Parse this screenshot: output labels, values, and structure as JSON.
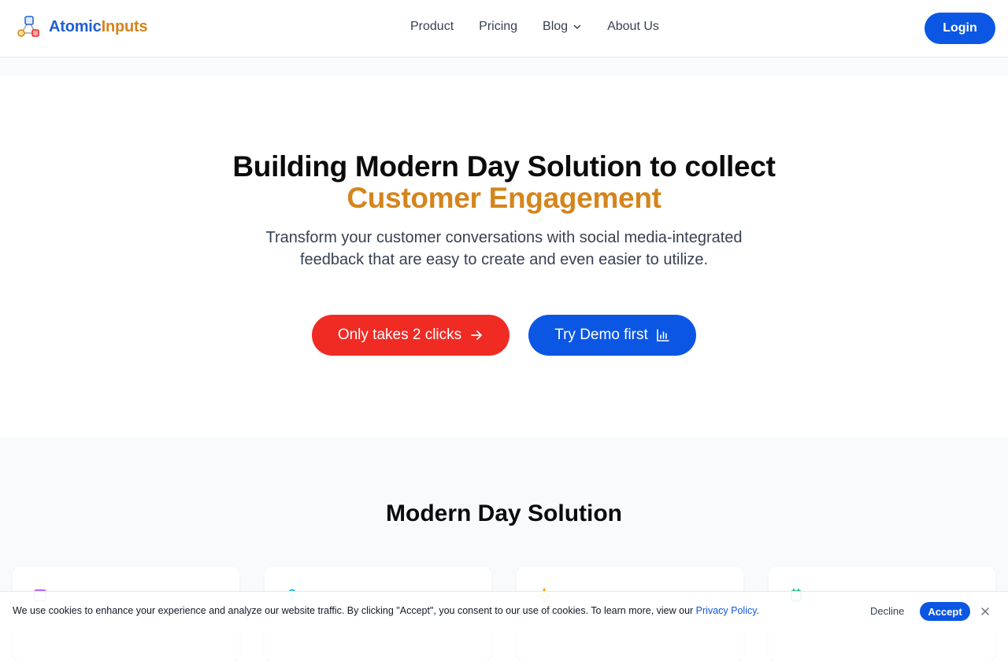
{
  "header": {
    "logo_text_a": "Atomic",
    "logo_text_b": "Inputs",
    "nav": [
      {
        "label": "Product"
      },
      {
        "label": "Pricing"
      },
      {
        "label": "Blog",
        "icon": "chevron-down-icon"
      },
      {
        "label": "About Us"
      }
    ],
    "login_label": "Login"
  },
  "hero": {
    "title_line1": "Building Modern Day Solution to collect",
    "title_line2": "Customer Engagement",
    "subtitle_line1": "Transform your customer conversations with social media-integrated",
    "subtitle_line2": "feedback that are easy to create and even easier to utilize.",
    "primary_cta": {
      "label": "Only takes 2 clicks",
      "icon": "arrow-right-icon"
    },
    "secondary_cta": {
      "label": "Try Demo first",
      "icon": "bar-chart-icon"
    }
  },
  "solution": {
    "title": "Modern Day Solution",
    "cards": [
      {
        "title": "",
        "icon": "cube-icon"
      },
      {
        "title": "",
        "icon": "pin-icon"
      },
      {
        "title": "",
        "icon": "sparkle-icon"
      },
      {
        "title": "",
        "icon": "chip-icon"
      }
    ]
  },
  "cookie": {
    "text": "We use cookies to enhance your experience and analyze our website traffic. By clicking \"Accept\", you consent to our use of cookies. To learn more, view our ",
    "link": "Privacy Policy",
    "period": ".",
    "decline": "Decline",
    "accept": "Accept"
  },
  "colors": {
    "brand_blue": "#0b57e3",
    "brand_orange": "#d4851c",
    "cta_red": "#ef2b24"
  }
}
